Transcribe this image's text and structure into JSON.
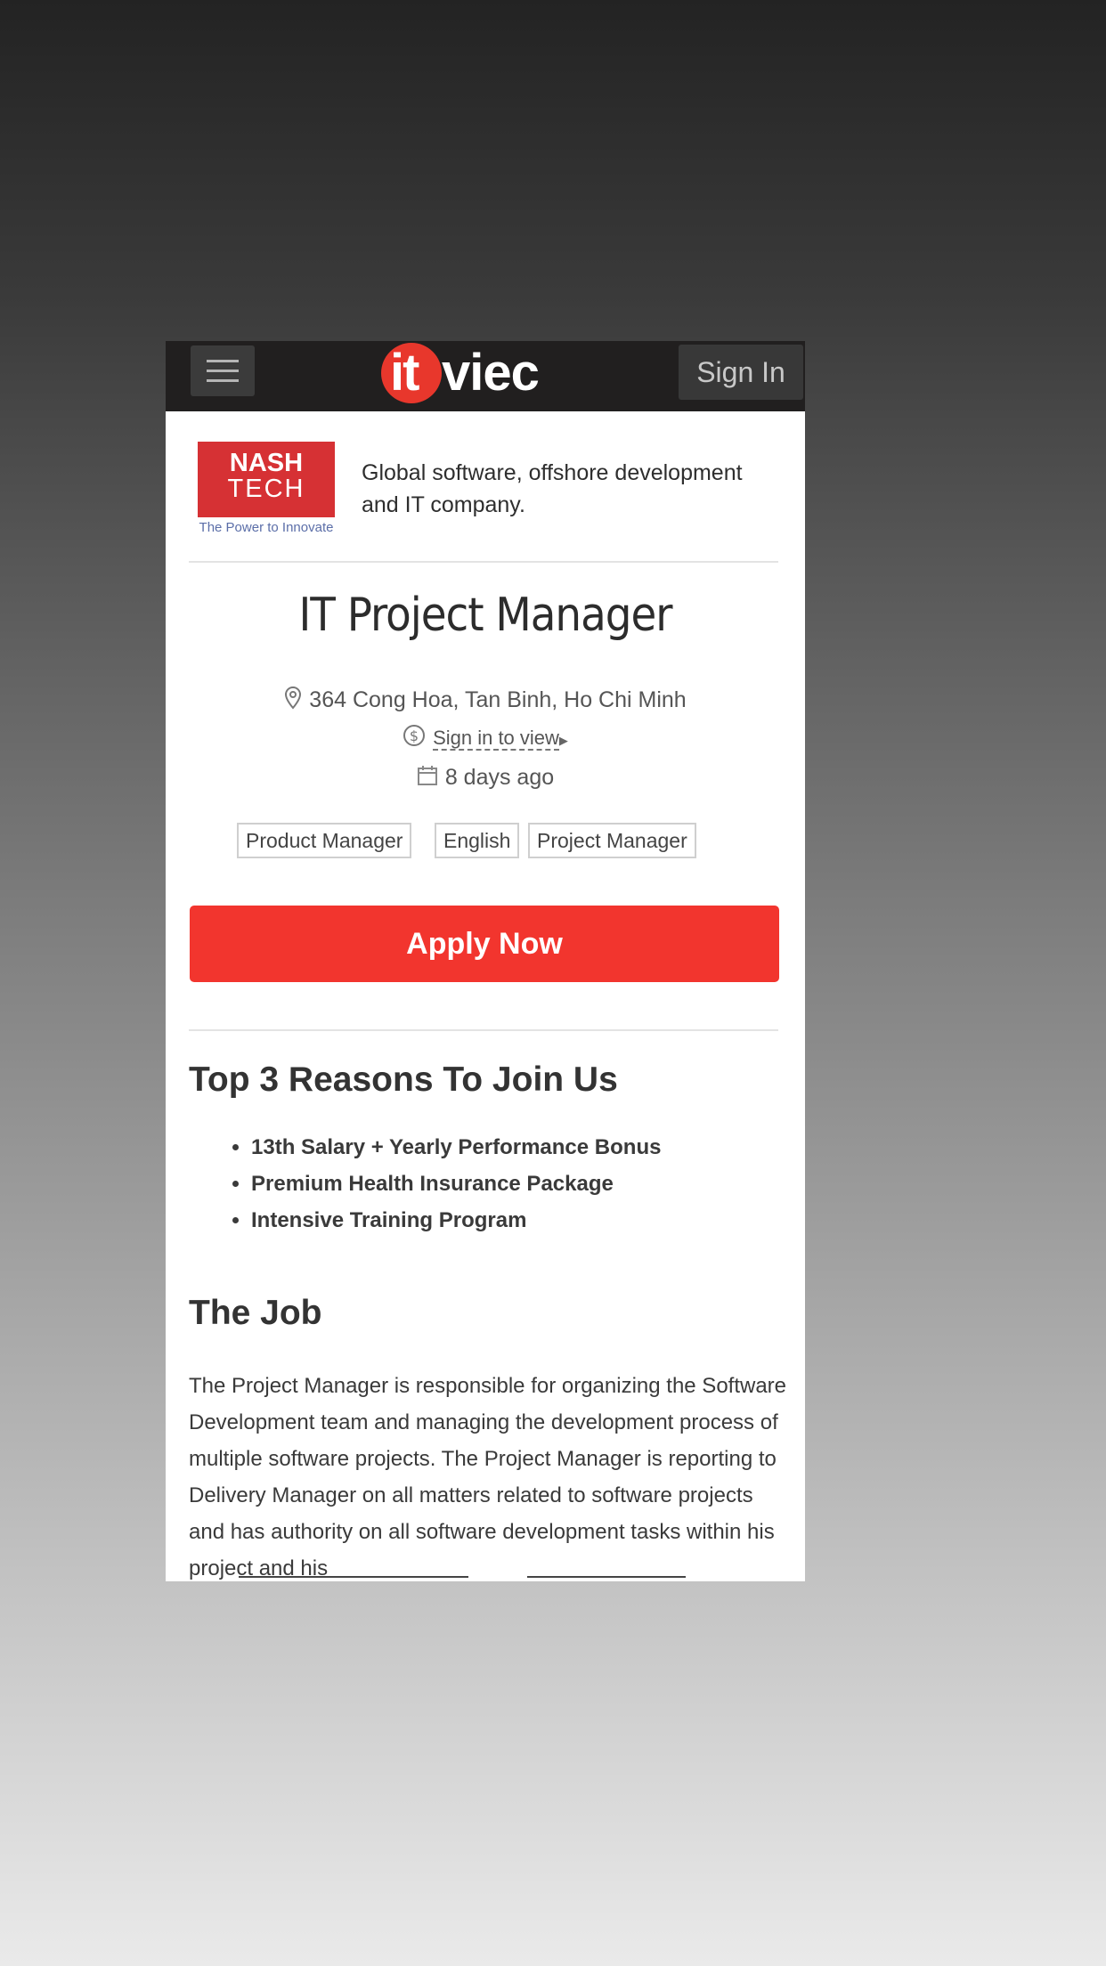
{
  "header": {
    "menu_icon": "hamburger-menu-icon",
    "logo_it": "it",
    "logo_viec": "viec",
    "sign_in_label": "Sign In"
  },
  "company": {
    "logo_line1": "NASH",
    "logo_line2": "TECH",
    "logo_tagline": "The Power to Innovate",
    "description": "Global software, offshore development and IT company.",
    "brand_color": "#d63134"
  },
  "job": {
    "title": "IT Project Manager",
    "location": "364 Cong Hoa, Tan Binh, Ho Chi Minh",
    "salary_link": "Sign in to view",
    "posted": "8 days ago",
    "tags": [
      "Product Manager",
      "English",
      "Project Manager"
    ],
    "apply_label": "Apply Now",
    "apply_color": "#f2352e"
  },
  "reasons": {
    "title": "Top 3 Reasons To Join Us",
    "items": [
      "13th Salary + Yearly Performance Bonus",
      "Premium Health Insurance Package",
      "Intensive Training Program"
    ]
  },
  "the_job": {
    "title": "The Job",
    "description": "The Project Manager is responsible for organizing the Software Development team and managing the development process of multiple software projects. The Project Manager is reporting to Delivery Manager on all matters related to software projects and has authority on all software development tasks within his project and his"
  }
}
